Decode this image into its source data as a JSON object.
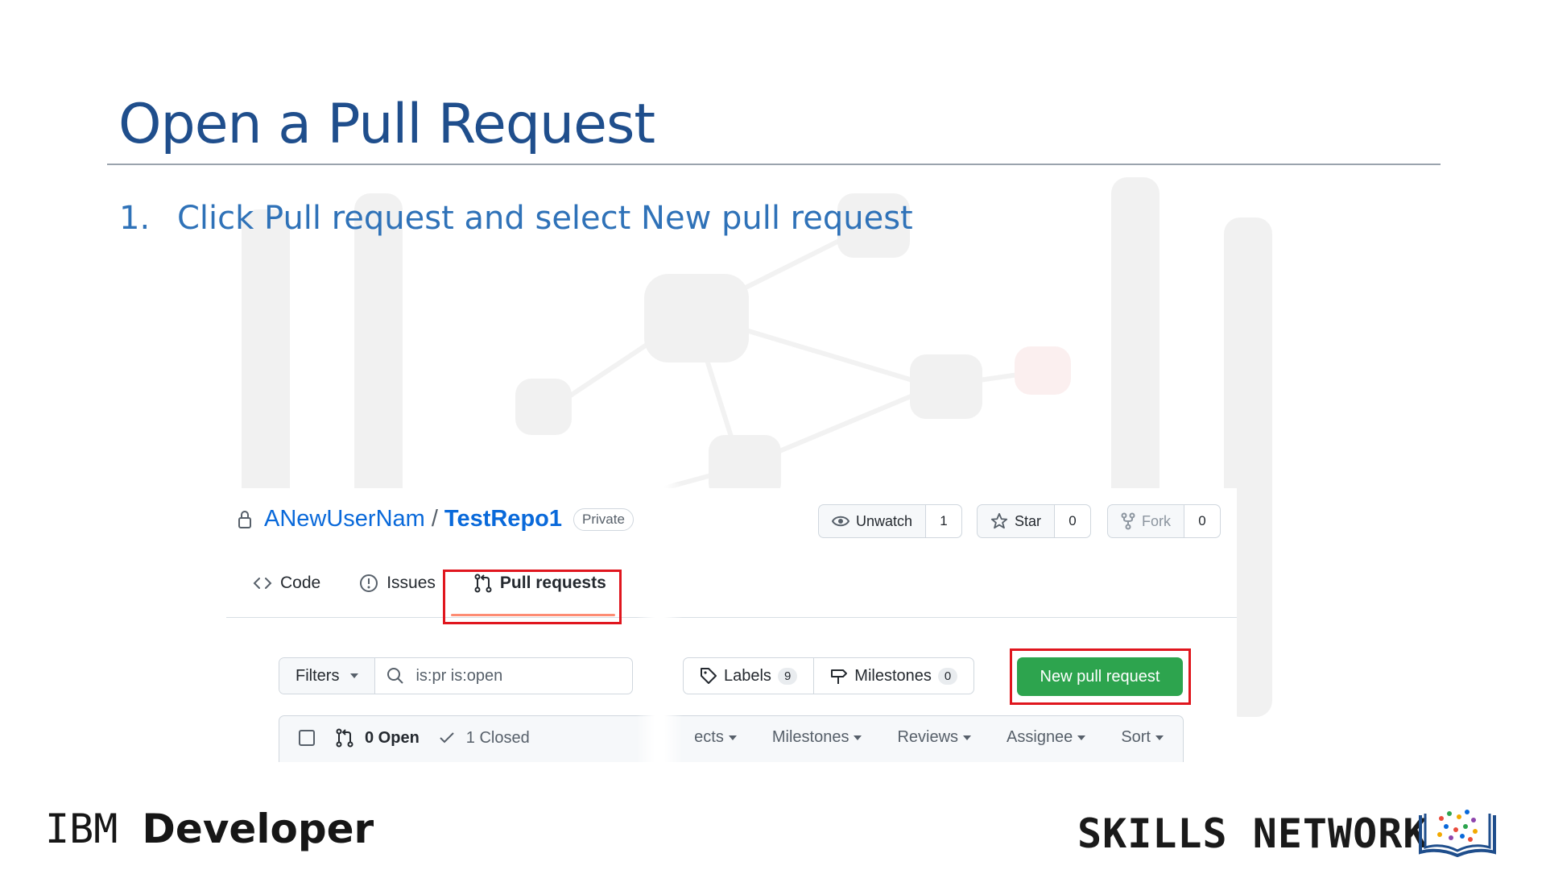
{
  "slide": {
    "title": "Open a Pull Request",
    "step_number": "1.",
    "step_text": "Click Pull request and select New pull request"
  },
  "repo": {
    "owner": "ANewUserNam",
    "separator": "/",
    "name": "TestRepo1",
    "visibility": "Private"
  },
  "actions": {
    "unwatch_label": "Unwatch",
    "unwatch_count": "1",
    "star_label": "Star",
    "star_count": "0",
    "fork_label": "Fork",
    "fork_count": "0"
  },
  "tabs": [
    {
      "label": "Code",
      "icon": "code-icon"
    },
    {
      "label": "Issues",
      "icon": "issue-icon"
    },
    {
      "label": "Pull requests",
      "icon": "pull-request-icon",
      "active": true
    }
  ],
  "toolbar": {
    "filters_label": "Filters",
    "search_value": "is:pr is:open",
    "labels_label": "Labels",
    "labels_count": "9",
    "milestones_label": "Milestones",
    "milestones_count": "0",
    "new_pr_label": "New pull request",
    "new_pr_color": "#2da44e"
  },
  "list": {
    "open_label": "0 Open",
    "closed_label": "1 Closed",
    "projects_label": "ects",
    "milestones_label": "Milestones",
    "reviews_label": "Reviews",
    "assignee_label": "Assignee",
    "sort_label": "Sort"
  },
  "footer": {
    "ibm_prefix": "IBM",
    "ibm_suffix": "Developer",
    "skills_network": "SKILLS NETWORK"
  },
  "highlight_color": "#e0161e",
  "title_color": "#1f4e8c"
}
